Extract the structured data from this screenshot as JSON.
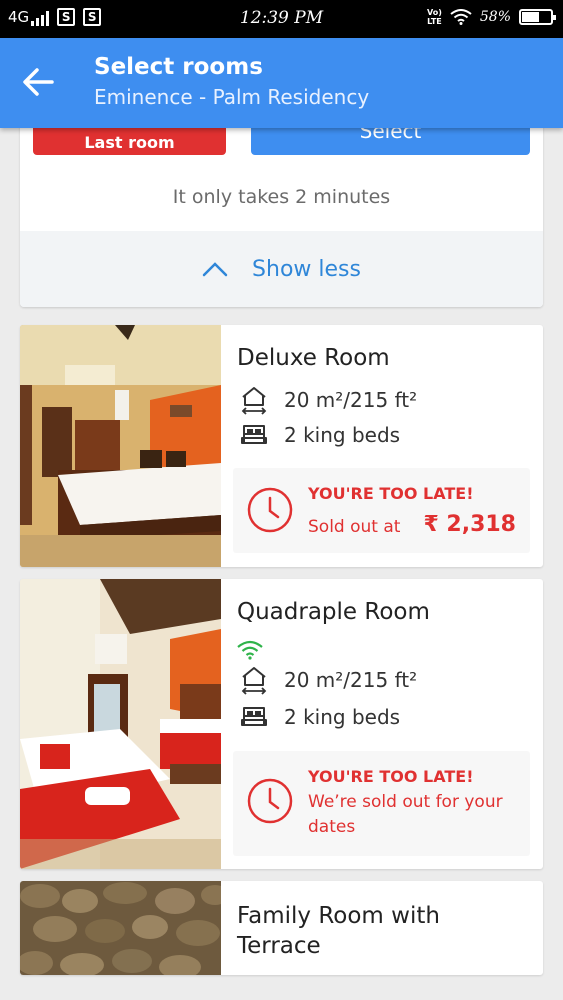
{
  "status_bar": {
    "network": "4G",
    "time": "12:39 PM",
    "volte": "Vo) LTE",
    "battery": "58%",
    "battery_level": 0.58
  },
  "header": {
    "title": "Select rooms",
    "subtitle": "Eminence - Palm Residency"
  },
  "panel": {
    "last_room_label": "Last room",
    "select_label": "Select",
    "takes_text": "It only takes 2 minutes",
    "show_less_label": "Show less"
  },
  "rooms": [
    {
      "name": "Deluxe Room",
      "size": "20 m²/215 ft²",
      "beds": "2 king beds",
      "status_title": "YOU'RE TOO LATE!",
      "status_text": "Sold out at",
      "price": "₹ 2,318"
    },
    {
      "name": "Quadraple Room",
      "size": "20 m²/215 ft²",
      "beds": "2 king beds",
      "status_title": "YOU'RE TOO LATE!",
      "status_text": "We’re sold out for your dates"
    },
    {
      "name": "Family Room with Terrace"
    }
  ],
  "colors": {
    "accent": "#3e8ef0",
    "alert": "#e03131",
    "link": "#2f86d8",
    "wifi": "#2fb34a"
  }
}
